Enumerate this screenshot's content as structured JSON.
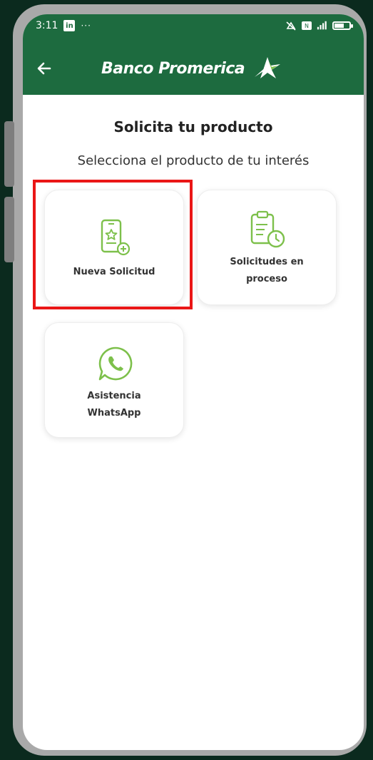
{
  "status_bar": {
    "time": "3:11",
    "app_icon_text": "in",
    "dots": "···"
  },
  "header": {
    "brand": "Banco Promerica"
  },
  "main": {
    "title": "Solicita tu producto",
    "subtitle": "Selecciona el producto de tu interés",
    "cards": [
      {
        "label_line1": "Nueva Solicitud",
        "label_line2": ""
      },
      {
        "label_line1": "Solicitudes en",
        "label_line2": "proceso"
      },
      {
        "label_line1": "Asistencia",
        "label_line2": "WhatsApp"
      }
    ]
  },
  "colors": {
    "header": "#1d6b3f",
    "icon_green": "#7dc04b",
    "highlight": "#ea1616"
  }
}
